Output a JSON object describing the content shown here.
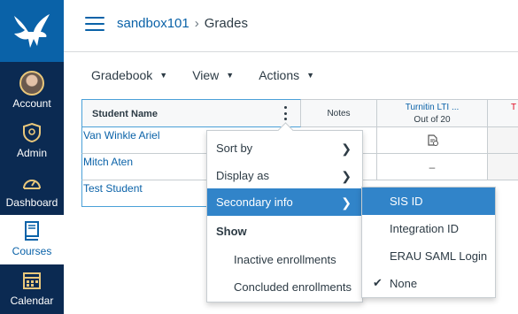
{
  "nav": {
    "items": [
      {
        "label": "Account",
        "icon": "avatar"
      },
      {
        "label": "Admin",
        "icon": "shield-icon"
      },
      {
        "label": "Dashboard",
        "icon": "dashboard-icon"
      },
      {
        "label": "Courses",
        "icon": "book-icon"
      },
      {
        "label": "Calendar",
        "icon": "calendar-icon"
      }
    ],
    "active": "Courses"
  },
  "breadcrumb": {
    "course": "sandbox101",
    "separator": "›",
    "page": "Grades"
  },
  "toolbar": {
    "gradebook": "Gradebook",
    "view": "View",
    "actions": "Actions"
  },
  "grid": {
    "headers": {
      "student": "Student Name",
      "notes": "Notes",
      "assignment_title": "Turnitin LTI ...",
      "assignment_points": "Out of 20",
      "next_col_fragment": "T"
    },
    "rows": [
      {
        "name": "Van Winkle Ariel",
        "score": ""
      },
      {
        "name": "Mitch Aten",
        "score": "–"
      },
      {
        "name": "Test Student",
        "score": ""
      }
    ]
  },
  "menu": {
    "items": [
      "Sort by",
      "Display as",
      "Secondary info"
    ],
    "show_heading": "Show",
    "show_items": [
      "Inactive enrollments",
      "Concluded enrollments"
    ]
  },
  "submenu": {
    "items": [
      "SIS ID",
      "Integration ID",
      "ERAU SAML Login",
      "None"
    ],
    "checked": "None",
    "selected": "SIS ID"
  },
  "colors": {
    "nav_bg": "#0b2a52",
    "logo_bg": "#0a62a8",
    "link": "#0a62a8",
    "highlight": "#3184c9",
    "flag": "#08c65a"
  }
}
